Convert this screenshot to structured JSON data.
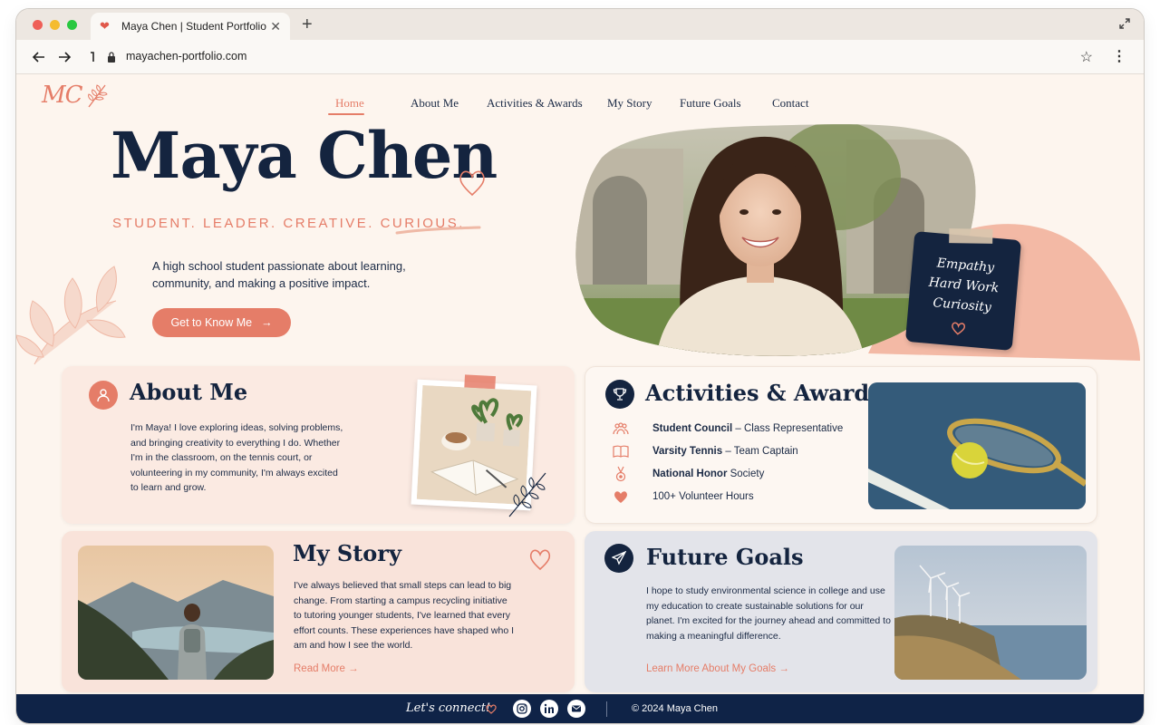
{
  "browser": {
    "tab_title": "Maya Chen | Student Portfolio",
    "url": "mayachen-portfolio.com"
  },
  "logo": "MC",
  "nav": [
    "Home",
    "About Me",
    "Activities & Awards",
    "My Story",
    "Future Goals",
    "Contact"
  ],
  "hero": {
    "name": "Maya Chen",
    "tagline": "STUDENT. LEADER. CREATIVE. CURIOUS.",
    "description": "A high school student passionate about learning, community, and making a positive impact.",
    "cta": "Get to Know Me",
    "note_words": [
      "Empathy",
      "Hard Work",
      "Curiosity"
    ]
  },
  "about": {
    "title": "About Me",
    "body": "I'm Maya! I love exploring ideas, solving problems, and bringing creativity to everything I do. Whether I'm in the classroom, on the tennis court, or volunteering in my community, I'm always excited to learn and grow."
  },
  "activities": {
    "title": "Activities & Awards",
    "items": [
      {
        "bold": "Student Council",
        "rest": " – Class Representative",
        "icon": "group-icon"
      },
      {
        "bold": "Varsity Tennis",
        "rest": " – Team Captain",
        "icon": "book-icon"
      },
      {
        "bold": "National Honor",
        "rest": " Society",
        "icon": "medal-icon"
      },
      {
        "bold": "",
        "rest": "100+ Volunteer Hours",
        "icon": "heart-icon"
      }
    ]
  },
  "story": {
    "title": "My Story",
    "body": "I've always believed that small steps can lead to big change. From starting a campus recycling initiative to tutoring younger students, I've learned that every effort counts. These experiences have shaped who I am and how I see the world.",
    "link": "Read More"
  },
  "goals": {
    "title": "Future Goals",
    "body": "I hope to study environmental science in college and use my education to create sustainable solutions for our planet. I'm excited for the journey ahead and committed to making a meaningful difference.",
    "link": "Learn More About My Goals"
  },
  "footer": {
    "connect": "Let's connect!",
    "copyright": "© 2024 Maya Chen"
  },
  "colors": {
    "accent": "#e57d68",
    "navy": "#14243f",
    "background": "#fdf5ee"
  }
}
